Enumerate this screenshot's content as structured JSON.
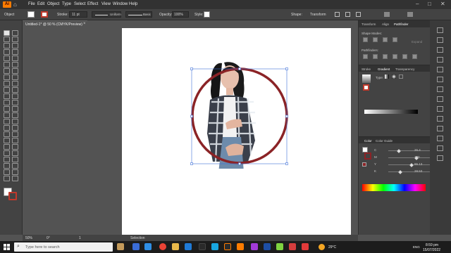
{
  "app": {
    "logo": "Ai",
    "home_icon": "home-icon"
  },
  "menu": [
    "File",
    "Edit",
    "Object",
    "Type",
    "Select",
    "Effect",
    "View",
    "Window",
    "Help"
  ],
  "control_bar": {
    "selection_label": "Object",
    "stroke_label": "Stroke:",
    "stroke_weight": "11 pt",
    "brush_label": "Uniform",
    "profile_label": "Basic",
    "opacity_label": "Opacity:",
    "opacity_value": "100%",
    "style_label": "Style:",
    "shape_label": "Shape:",
    "transform_label": "Transform"
  },
  "document": {
    "tab_title": "Untitled-1* @ 50 % (CMYK/Preview)"
  },
  "right_panel": {
    "tabs_top": [
      "Transform",
      "Align",
      "Pathfinder"
    ],
    "shape_modes_label": "Shape Modes:",
    "expand_label": "Expand",
    "pathfinders_label": "Pathfinders:",
    "tabs_mid": [
      "Stroke",
      "Gradient",
      "Transparency"
    ],
    "type_label": "Type:",
    "tabs_color": [
      "Color",
      "Color Guide"
    ],
    "color_values": [
      {
        "label": "C",
        "value": "26.4"
      },
      {
        "label": "M",
        "value": "100"
      },
      {
        "label": "Y",
        "value": "86.13"
      },
      {
        "label": "K",
        "value": "28.53"
      }
    ],
    "percent": "%"
  },
  "status": {
    "zoom": "50%",
    "rotation": "0°",
    "artboard": "1",
    "mode": "Selection"
  },
  "taskbar": {
    "search_placeholder": "Type here to search",
    "weather": "29°C",
    "time": "8:59 pm",
    "date": "15/07/2022",
    "lang": "ENG"
  },
  "colors": {
    "stroke_red": "#8b2326",
    "selection_blue": "#3f70d8"
  }
}
